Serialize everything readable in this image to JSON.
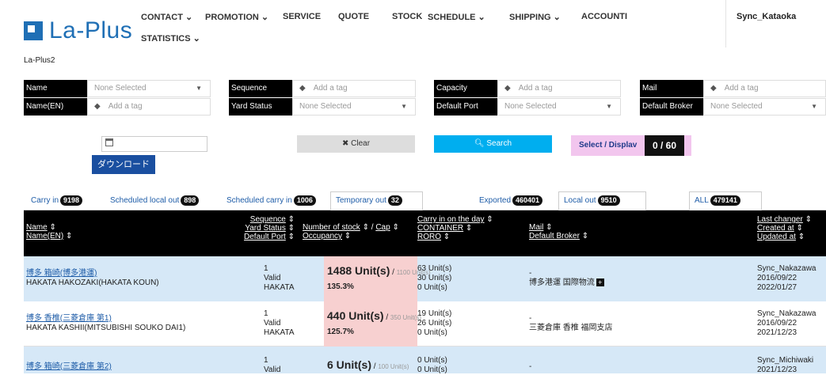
{
  "app": {
    "logo": "La-Plus",
    "site": "La-Plus2",
    "user": "Sync_Kataoka"
  },
  "nav": {
    "contact": "CONTACT ⌄",
    "promotion": "PROMOTION ⌄",
    "service": "SERVICE",
    "quote": "QUOTE",
    "stock": "STOCK",
    "schedule": "SCHEDULE ⌄",
    "shipping": "SHIPPING ⌄",
    "accounting": "ACCOUNTI",
    "statistics": "STATISTICS ⌄"
  },
  "filters": {
    "name": {
      "label": "Name",
      "value": "None Selected"
    },
    "name_en": {
      "label": "Name(EN)",
      "placeholder": "Add a tag"
    },
    "sequence": {
      "label": "Sequence",
      "placeholder": "Add a tag"
    },
    "yard_status": {
      "label": "Yard Status",
      "value": "None Selected"
    },
    "capacity": {
      "label": "Capacity",
      "placeholder": "Add a tag"
    },
    "default_port": {
      "label": "Default Port",
      "value": "None Selected"
    },
    "mail": {
      "label": "Mail",
      "placeholder": "Add a tag"
    },
    "default_broker": {
      "label": "Default Broker",
      "value": "None Selected"
    }
  },
  "actions": {
    "download": "ダウンロード",
    "clear": "Clear",
    "search": "Search",
    "select_display": "Select / Displav",
    "select_count": "0 / 60"
  },
  "tabs": [
    {
      "label": "Carry in",
      "count": "9198"
    },
    {
      "label": "Scheduled local out",
      "count": "898"
    },
    {
      "label": "Scheduled carry in",
      "count": "1006"
    },
    {
      "label": "Temporary out",
      "count": "32"
    },
    {
      "label": "Exported",
      "count": "460401"
    },
    {
      "label": "Local out",
      "count": "9510"
    },
    {
      "label": "ALL",
      "count": "479141"
    }
  ],
  "columns": {
    "name": "Name",
    "name_en": "Name(EN)",
    "sequence": "Sequence",
    "yard_status": "Yard Status",
    "default_port": "Default Port",
    "num_stock": "Number of stock",
    "cap": "Cap",
    "occupancy": "Occupancy",
    "carry_in_day": "Carry in on the day",
    "container": "CONTAINER",
    "roro": "RORO",
    "mail": "Mail",
    "default_broker": "Default Broker",
    "last_changer": "Last changer",
    "created_at": "Created at",
    "updated_at": "Updated at"
  },
  "rows": [
    {
      "name": "博多 箱崎(博多港運)",
      "name_en": "HAKATA HAKOZAKI(HAKATA KOUN)",
      "sequence": "1",
      "status": "Valid",
      "port": "HAKATA",
      "stock": "1488 Unit(s)",
      "cap": "1100 Unit(s)",
      "occupancy": "135.3%",
      "carry_in": "63 Unit(s)",
      "container": "30 Unit(s)",
      "roro": "0 Unit(s)",
      "mail": "-",
      "broker": "博多港運 国際物流",
      "changer": "Sync_Nakazawa",
      "created": "2016/09/22",
      "updated": "2022/01/27"
    },
    {
      "name": "博多 香椎(三菱倉庫 第1)",
      "name_en": "HAKATA KASHII(MITSUBISHI SOUKO DAI1)",
      "sequence": "1",
      "status": "Valid",
      "port": "HAKATA",
      "stock": "440 Unit(s)",
      "cap": "350 Unit(s)",
      "occupancy": "125.7%",
      "carry_in": "19 Unit(s)",
      "container": "26 Unit(s)",
      "roro": "0 Unit(s)",
      "mail": "-",
      "broker": "三菱倉庫 香椎 福岡支店",
      "changer": "Sync_Nakazawa",
      "created": "2016/09/22",
      "updated": "2021/12/23"
    },
    {
      "name": "博多 箱崎(三菱倉庫 第2)",
      "sequence": "1",
      "status": "Valid",
      "stock": "6 Unit(s)",
      "cap": "100 Unit(s)",
      "carry_in": "0 Unit(s)",
      "container": "0 Unit(s)",
      "mail": "-",
      "changer": "Sync_Michiwaki",
      "created": "2021/12/23"
    }
  ],
  "colors": {
    "accent": "#1f6fb5",
    "stock_bg": "#f7d0d0",
    "row_alt": "#d6e8f7",
    "search": "#00aeef",
    "select": "#f2c6ee"
  }
}
